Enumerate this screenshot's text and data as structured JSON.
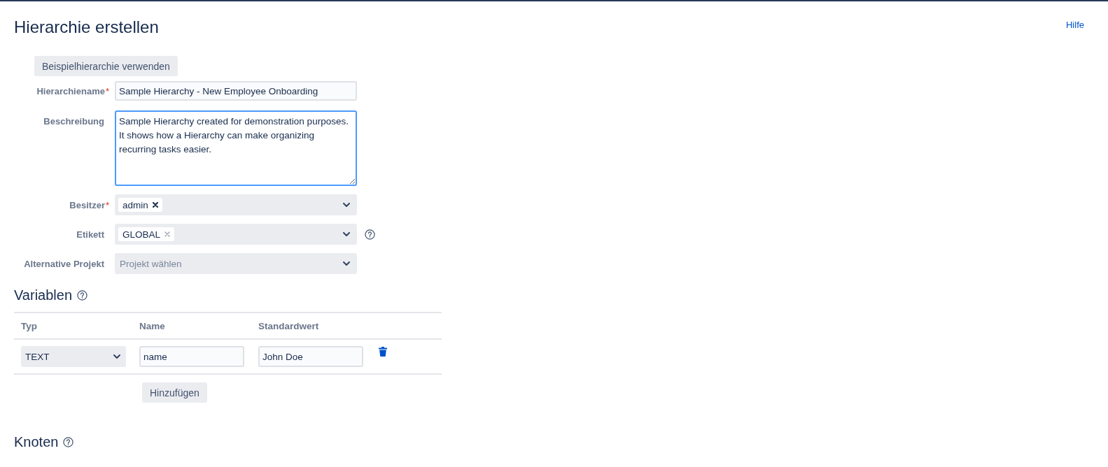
{
  "header": {
    "title": "Hierarchie erstellen",
    "help_link": "Hilfe"
  },
  "sample_button": "Beispielhierarchie verwenden",
  "fields": [
    {
      "kind": "text",
      "label": "Hierarchiename",
      "required_mark": "*",
      "value": "Sample Hierarchy - New Employee Onboarding",
      "focused": false,
      "help": false
    },
    {
      "kind": "textarea",
      "label": "Beschreibung",
      "value": "Sample Hierarchy created for demonstration purposes. It shows how a Hierarchy can make organizing recurring tasks easier.",
      "focused": true,
      "help": false
    },
    {
      "kind": "userpicker",
      "label": "Besitzer",
      "required_mark": "*",
      "tags": [
        "admin"
      ],
      "focused": false,
      "help": false
    },
    {
      "kind": "labelpicker",
      "label": "Etikett",
      "tags": [
        "GLOBAL"
      ],
      "focused": false,
      "help": true
    },
    {
      "kind": "select",
      "label": "Alternative Projekt",
      "placeholder": "Projekt wählen",
      "focused": false,
      "help": false
    }
  ],
  "variables": {
    "title": "Variablen",
    "help": true,
    "columns": [
      "Typ",
      "Name",
      "Standardwert"
    ],
    "rows": [
      {
        "type": "TEXT",
        "name": "name",
        "default_value": "John Doe"
      }
    ],
    "add_button": "Hinzufügen"
  },
  "nodes": {
    "title": "Knoten",
    "help": true
  }
}
